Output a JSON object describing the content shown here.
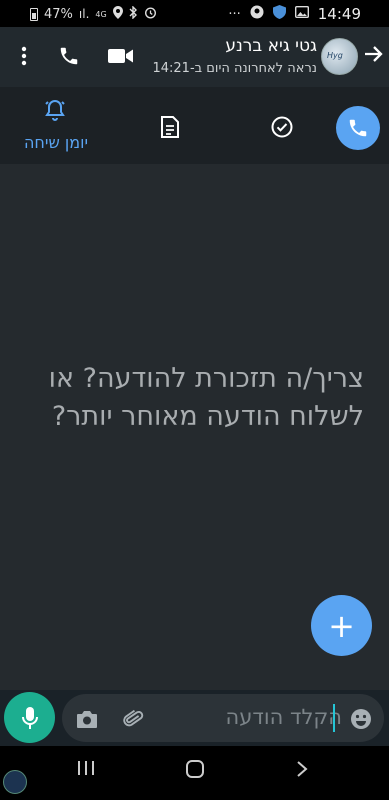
{
  "status_bar": {
    "battery": "47%",
    "network": "4G",
    "time": "14:49",
    "more": "···"
  },
  "header": {
    "contact_name": "גטי גיא ברנע",
    "last_seen": "נראה לאחרונה היום ב-14:21",
    "avatar_text": "Hyg"
  },
  "toolbar": {
    "call_log_label": "יומן שיחה"
  },
  "chat": {
    "prompt_text": "צריך/ה תזכורת להודעה? או לשלוח הודעה מאוחר יותר?",
    "fab_symbol": "+"
  },
  "composer": {
    "placeholder": "הקלד הודעה"
  },
  "colors": {
    "accent": "#5aa4f2",
    "mic": "#1cae90",
    "header_bg": "#22292e",
    "chat_bg": "#252a2e"
  },
  "icons": [
    "battery-icon",
    "signal-icon",
    "location-icon",
    "bluetooth-icon",
    "alarm-icon",
    "shield-icon",
    "image-icon",
    "more-vert-icon",
    "phone-icon",
    "video-icon",
    "arrow-right-icon",
    "check-circle-icon",
    "document-icon",
    "bell-icon",
    "emoji-icon",
    "attach-icon",
    "camera-icon",
    "mic-icon",
    "recent-apps-icon",
    "home-icon",
    "back-icon"
  ]
}
